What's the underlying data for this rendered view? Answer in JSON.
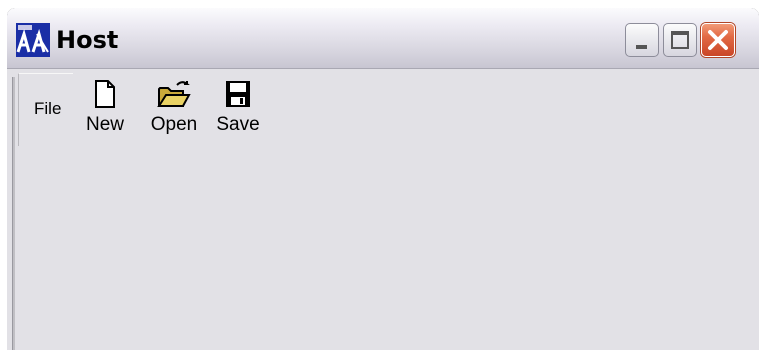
{
  "window": {
    "title": "Host"
  },
  "toolbar": {
    "file_tab": "File",
    "items": [
      {
        "label": "New",
        "icon": "new-document-icon"
      },
      {
        "label": "Open",
        "icon": "open-folder-icon"
      },
      {
        "label": "Save",
        "icon": "floppy-disk-icon"
      }
    ]
  },
  "colors": {
    "client_bg": "#e2e1e6",
    "close_button": "#e26a45",
    "folder": "#e0c44a"
  }
}
